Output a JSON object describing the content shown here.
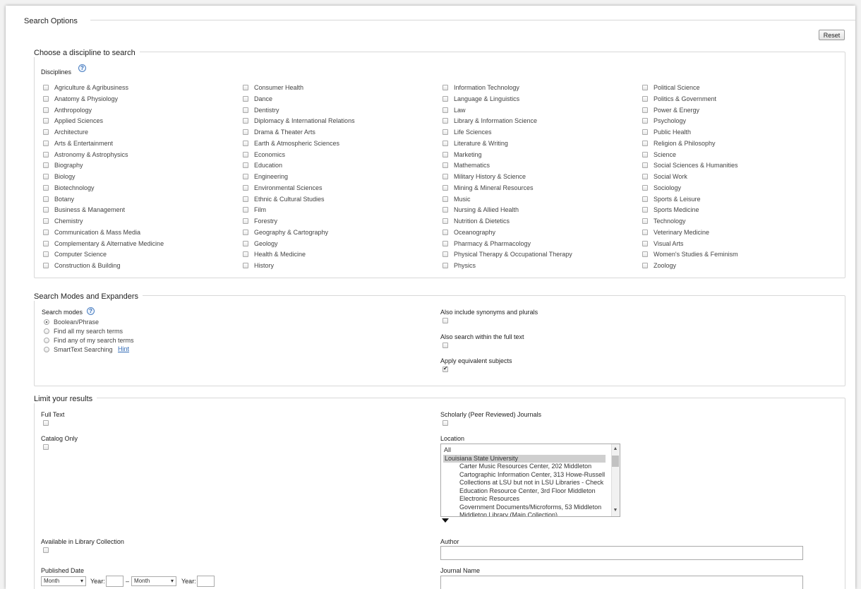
{
  "search_options": {
    "title": "Search Options",
    "reset_label": "Reset"
  },
  "disciplines_section": {
    "title": "Choose a discipline to search",
    "label": "Disciplines",
    "help": "?",
    "columns": [
      [
        "Agriculture & Agribusiness",
        "Anatomy & Physiology",
        "Anthropology",
        "Applied Sciences",
        "Architecture",
        "Arts & Entertainment",
        "Astronomy & Astrophysics",
        "Biography",
        "Biology",
        "Biotechnology",
        "Botany",
        "Business & Management",
        "Chemistry",
        "Communication & Mass Media",
        "Complementary & Alternative Medicine",
        "Computer Science",
        "Construction & Building"
      ],
      [
        "Consumer Health",
        "Dance",
        "Dentistry",
        "Diplomacy & International Relations",
        "Drama & Theater Arts",
        "Earth & Atmospheric Sciences",
        "Economics",
        "Education",
        "Engineering",
        "Environmental Sciences",
        "Ethnic & Cultural Studies",
        "Film",
        "Forestry",
        "Geography & Cartography",
        "Geology",
        "Health & Medicine",
        "History"
      ],
      [
        "Information Technology",
        "Language & Linguistics",
        "Law",
        "Library & Information Science",
        "Life Sciences",
        "Literature & Writing",
        "Marketing",
        "Mathematics",
        "Military History & Science",
        "Mining & Mineral Resources",
        "Music",
        "Nursing & Allied Health",
        "Nutrition & Dietetics",
        "Oceanography",
        "Pharmacy & Pharmacology",
        "Physical Therapy & Occupational Therapy",
        "Physics"
      ],
      [
        "Political Science",
        "Politics & Government",
        "Power & Energy",
        "Psychology",
        "Public Health",
        "Religion & Philosophy",
        "Science",
        "Social Sciences & Humanities",
        "Social Work",
        "Sociology",
        "Sports & Leisure",
        "Sports Medicine",
        "Technology",
        "Veterinary Medicine",
        "Visual Arts",
        "Women's Studies & Feminism",
        "Zoology"
      ]
    ]
  },
  "modes_section": {
    "title": "Search Modes and Expanders",
    "modes_label": "Search modes",
    "help": "?",
    "modes": [
      "Boolean/Phrase",
      "Find all my search terms",
      "Find any of my search terms",
      "SmartText Searching"
    ],
    "selected_mode": "Boolean/Phrase",
    "hint_label": "Hint",
    "expanders": [
      {
        "label": "Also include synonyms and plurals",
        "checked": false
      },
      {
        "label": "Also search within the full text",
        "checked": false
      },
      {
        "label": "Apply equivalent subjects",
        "checked": true
      }
    ]
  },
  "limits_section": {
    "title": "Limit your results",
    "full_text_label": "Full Text",
    "scholarly_label": "Scholarly (Peer Reviewed) Journals",
    "catalog_only_label": "Catalog Only",
    "location_label": "Location",
    "location_options": [
      "All",
      "Louisiana State University",
      "Carter Music Resources Center, 202 Middleton",
      "Cartographic Information Center, 313 Howe-Russell",
      "Collections at LSU but not in LSU Libraries - Check",
      "Education Resource Center, 3rd Floor Middleton",
      "Electronic Resources",
      "Government Documents/Microforms, 53 Middleton",
      "Middleton Library (Main Collection)"
    ],
    "location_selected": "Louisiana State University",
    "available_label": "Available in Library Collection",
    "author_label": "Author",
    "published_date_label": "Published Date",
    "month_placeholder": "Month",
    "year_label": "Year:",
    "dash": "–",
    "journal_name_label": "Journal Name"
  }
}
